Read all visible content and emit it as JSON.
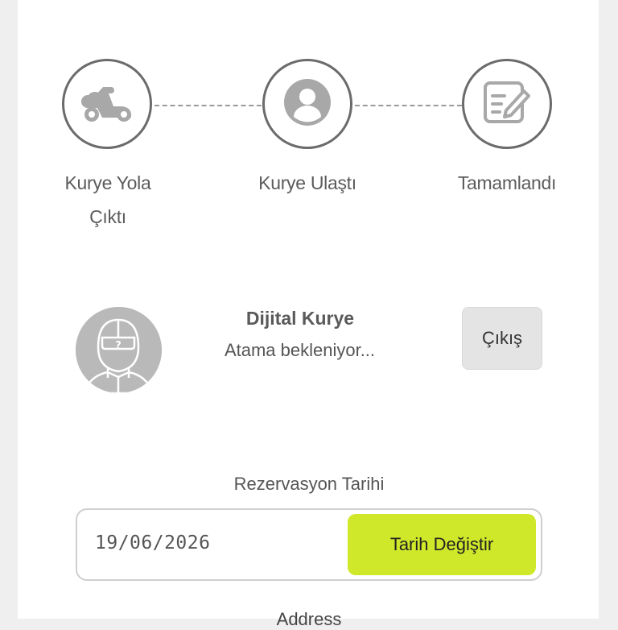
{
  "stepper": {
    "steps": [
      {
        "label_line1": "Kurye Yola",
        "label_line2": "Çıktı",
        "icon": "scooter-icon"
      },
      {
        "label_line1": "Kurye Ulaştı",
        "label_line2": "",
        "icon": "user-icon"
      },
      {
        "label_line1": "Tamamlandı",
        "label_line2": "",
        "icon": "edit-note-icon"
      }
    ]
  },
  "courier": {
    "name": "Dijital Kurye",
    "status": "Atama bekleniyor...",
    "avatar_icon": "unknown-courier-avatar-icon",
    "exit_label": "Çıkış"
  },
  "reservation": {
    "label": "Rezervasyon Tarihi",
    "date_value": "19/06/2026",
    "change_button_label": "Tarih Değiştir"
  },
  "address": {
    "label": "Address"
  },
  "colors": {
    "accent": "#cfe82a",
    "icon_gray": "#a8a8a8",
    "circle_border": "#6b6b6b",
    "background": "#efefef"
  }
}
